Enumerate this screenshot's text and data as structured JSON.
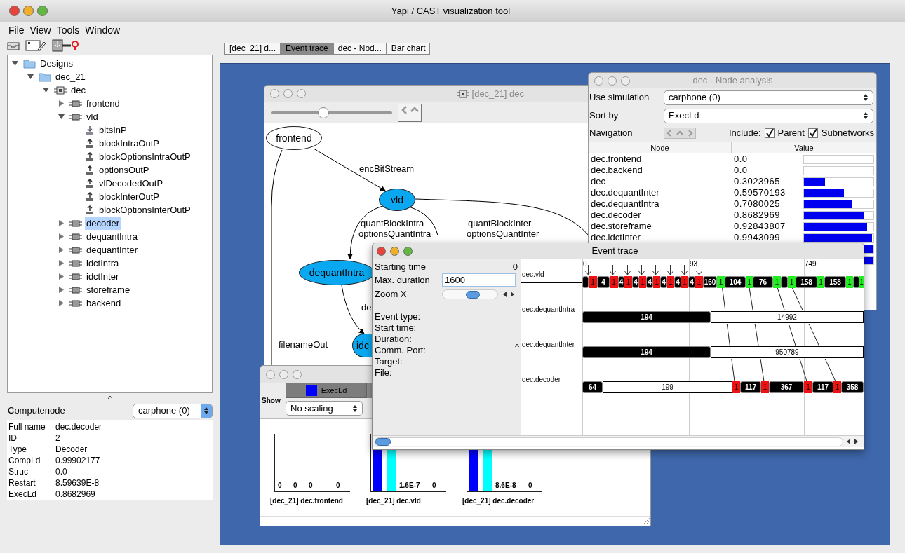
{
  "window": {
    "title": "Yapi / CAST visualization tool",
    "active": true
  },
  "menu": [
    {
      "label": "File"
    },
    {
      "label": "View"
    },
    {
      "label": "Tools"
    },
    {
      "label": "Window"
    }
  ],
  "tree": [
    {
      "label": "Designs",
      "kind": "folder",
      "expanded": true,
      "selected": false,
      "children": [
        {
          "label": "dec_21",
          "kind": "folder",
          "expanded": true,
          "selected": false,
          "children": [
            {
              "label": "dec",
              "kind": "network",
              "expanded": true,
              "selected": false,
              "children": [
                {
                  "label": "frontend",
                  "kind": "node",
                  "expanded": false,
                  "selected": false
                },
                {
                  "label": "vld",
                  "kind": "node",
                  "expanded": true,
                  "selected": false,
                  "children": [
                    {
                      "label": "bitsInP",
                      "kind": "in-port",
                      "selected": false
                    },
                    {
                      "label": "blockIntraOutP",
                      "kind": "out-port",
                      "selected": false
                    },
                    {
                      "label": "blockOptionsIntraOutP",
                      "kind": "out-port",
                      "selected": false
                    },
                    {
                      "label": "optionsOutP",
                      "kind": "out-port",
                      "selected": false
                    },
                    {
                      "label": "vlDecodedOutP",
                      "kind": "out-port",
                      "selected": false
                    },
                    {
                      "label": "blockInterOutP",
                      "kind": "out-port",
                      "selected": false
                    },
                    {
                      "label": "blockOptionsInterOutP",
                      "kind": "out-port",
                      "selected": false
                    }
                  ]
                },
                {
                  "label": "decoder",
                  "kind": "node",
                  "expanded": false,
                  "selected": true
                },
                {
                  "label": "dequantIntra",
                  "kind": "node",
                  "expanded": false,
                  "selected": false
                },
                {
                  "label": "dequantInter",
                  "kind": "node",
                  "expanded": false,
                  "selected": false
                },
                {
                  "label": "idctIntra",
                  "kind": "node",
                  "expanded": false,
                  "selected": false
                },
                {
                  "label": "idctInter",
                  "kind": "node",
                  "expanded": false,
                  "selected": false
                },
                {
                  "label": "storeframe",
                  "kind": "node",
                  "expanded": false,
                  "selected": false
                },
                {
                  "label": "backend",
                  "kind": "node",
                  "expanded": false,
                  "selected": false
                }
              ]
            }
          ]
        }
      ]
    }
  ],
  "compute_node": {
    "label": "Computenode",
    "simulation": "carphone (0)",
    "properties": [
      {
        "name": "Full name",
        "value": "dec.decoder"
      },
      {
        "name": "ID",
        "value": "2"
      },
      {
        "name": "Type",
        "value": "Decoder"
      },
      {
        "name": "CompLd",
        "value": "0.99902177"
      },
      {
        "name": "Struc",
        "value": "0.0"
      },
      {
        "name": "Restart",
        "value": "8.59639E-8"
      },
      {
        "name": "ExecLd",
        "value": "0.8682969"
      }
    ]
  },
  "tabs": [
    {
      "label": "[dec_21] d...",
      "selected": false
    },
    {
      "label": "Event trace",
      "selected": true
    },
    {
      "label": "dec - Nod...",
      "selected": false
    },
    {
      "label": "Bar chart",
      "selected": false
    }
  ],
  "graph_window": {
    "title": "[dec_21] dec",
    "active": false,
    "zoom": {
      "level": 0.42
    },
    "nodes": [
      {
        "label": "frontend",
        "highlighted": false
      },
      {
        "label": "vld",
        "highlighted": true
      },
      {
        "label": "dequantIntra",
        "highlighted": true
      },
      {
        "label": "idc",
        "highlighted": true
      }
    ],
    "edge_labels": [
      "encBitStream",
      "quantBlockIntra",
      "optionsQuantIntra",
      "quantBlockInter",
      "optionsQuantInter",
      "de",
      "filenameOut"
    ]
  },
  "bar_chart_window": {
    "active": false,
    "show_label": "Show",
    "series_tab": {
      "label": "ExecLd",
      "color": "#0000ff"
    },
    "scaling": "No scaling",
    "charts": [
      {
        "caption": "[dec_21] dec.frontend",
        "value_labels": [
          "0",
          "0",
          "0",
          "0"
        ]
      },
      {
        "caption": "[dec_21] dec.vld",
        "value_labels": [
          "1.6E-7",
          "0"
        ],
        "bars": [
          {
            "color": "#0000ff"
          },
          {
            "color": "#00ffff"
          }
        ]
      },
      {
        "caption": "[dec_21] dec.decoder",
        "value_labels": [
          "8.6E-8",
          "0"
        ],
        "bars": [
          {
            "color": "#0000ff"
          },
          {
            "color": "#00ffff"
          }
        ]
      }
    ]
  },
  "node_analysis": {
    "title": "dec - Node analysis",
    "active": false,
    "simulation_label": "Use simulation",
    "simulation": "carphone (0)",
    "sort_label": "Sort by",
    "sort_by": "ExecLd",
    "navigation_label": "Navigation",
    "include_label": "Include:",
    "parent": {
      "label": "Parent",
      "checked": true
    },
    "subnetworks": {
      "label": "Subnetworks",
      "checked": true
    },
    "columns": [
      "Node",
      "Value"
    ],
    "rows": [
      {
        "node": "dec.frontend",
        "value": "0.0"
      },
      {
        "node": "dec.backend",
        "value": "0.0"
      },
      {
        "node": "dec",
        "value": "0.3023965",
        "level": 0.3
      },
      {
        "node": "dec.dequantInter",
        "value": "0.59570193",
        "level": 0.58
      },
      {
        "node": "dec.dequantIntra",
        "value": "0.7080025",
        "level": 0.7
      },
      {
        "node": "dec.decoder",
        "value": "0.8682969",
        "level": 0.86
      },
      {
        "node": "dec.storeframe",
        "value": "0.92843807",
        "level": 0.91
      },
      {
        "node": "dec.idctInter",
        "value": "0.9943099",
        "level": 0.98
      },
      {
        "level": 0.99
      },
      {
        "level": 1
      }
    ]
  },
  "event_trace": {
    "title": "Event trace",
    "active": true,
    "starting_label": "Starting time",
    "starting_time": "0",
    "duration_label": "Max. duration",
    "max_duration": "1600",
    "zoom_label": "Zoom X",
    "zoom": {
      "level": 0.55
    },
    "details": [
      "Event type:",
      "Start time:",
      "Duration:",
      "Comm. Port:",
      "Target:",
      "File:"
    ],
    "ticks": [
      "0",
      "93",
      "749"
    ],
    "tracks": [
      {
        "name": "dec.vld",
        "segments": [
          {
            "kind": "busy"
          },
          {
            "kind": "wait",
            "label": "1"
          },
          {
            "kind": "busy",
            "label": "4"
          },
          {
            "kind": "wait",
            "label": "1"
          },
          {
            "kind": "busy",
            "label": "4"
          },
          {
            "kind": "wait",
            "label": "1"
          },
          {
            "kind": "busy",
            "label": "4"
          },
          {
            "kind": "wait",
            "label": "1"
          },
          {
            "kind": "busy",
            "label": "4"
          },
          {
            "kind": "wait",
            "label": "1"
          },
          {
            "kind": "busy",
            "label": "4"
          },
          {
            "kind": "wait",
            "label": "1"
          },
          {
            "kind": "busy",
            "label": "4"
          },
          {
            "kind": "wait",
            "label": "1"
          },
          {
            "kind": "busy",
            "label": "4"
          },
          {
            "kind": "wait",
            "label": "1"
          },
          {
            "kind": "busy",
            "label": "160"
          },
          {
            "kind": "sync",
            "label": "1"
          },
          {
            "kind": "busy",
            "label": "104"
          },
          {
            "kind": "sync",
            "label": "1"
          },
          {
            "kind": "busy",
            "label": "76"
          },
          {
            "kind": "sync",
            "label": "1"
          },
          {
            "kind": "busy"
          },
          {
            "kind": "sync",
            "label": "1"
          },
          {
            "kind": "busy",
            "label": "158"
          },
          {
            "kind": "sync",
            "label": "1"
          },
          {
            "kind": "busy",
            "label": "158"
          },
          {
            "kind": "sync",
            "label": "1"
          },
          {
            "kind": "busy"
          },
          {
            "kind": "sync",
            "label": "1"
          }
        ]
      },
      {
        "name": "dec.dequantIntra",
        "segments": [
          {
            "kind": "busy",
            "label": "194"
          },
          {
            "kind": "idle",
            "label": "14992"
          }
        ]
      },
      {
        "name": "dec.dequantInter",
        "segments": [
          {
            "kind": "busy",
            "label": "194"
          },
          {
            "kind": "idle",
            "label": "950789"
          }
        ]
      },
      {
        "name": "dec.decoder",
        "segments": [
          {
            "kind": "busy",
            "label": "64"
          },
          {
            "kind": "idle",
            "label": "199"
          },
          {
            "kind": "wait",
            "label": "1"
          },
          {
            "kind": "busy",
            "label": "117"
          },
          {
            "kind": "wait",
            "label": "1"
          },
          {
            "kind": "busy",
            "label": "367"
          },
          {
            "kind": "wait",
            "label": "1"
          },
          {
            "kind": "busy",
            "label": "117"
          },
          {
            "kind": "wait",
            "label": "1"
          },
          {
            "kind": "busy",
            "label": "358"
          }
        ]
      }
    ]
  }
}
